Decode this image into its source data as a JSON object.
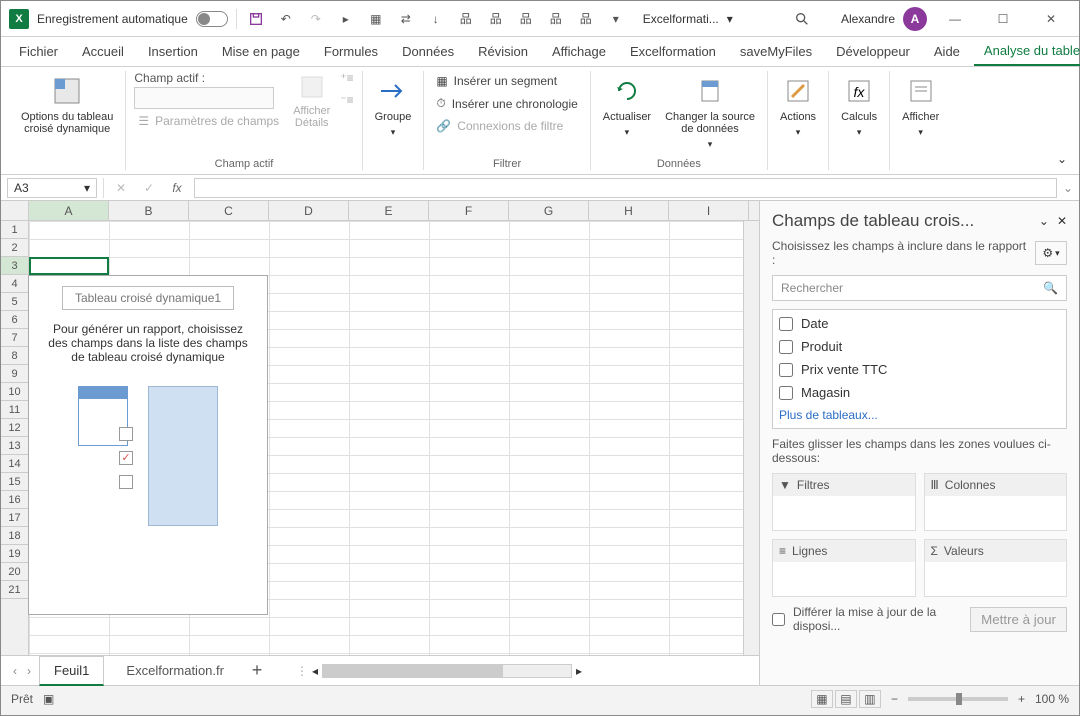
{
  "titlebar": {
    "autosave": "Enregistrement automatique",
    "filename": "Excelformati...",
    "user": "Alexandre",
    "user_initial": "A"
  },
  "tabs": [
    "Fichier",
    "Accueil",
    "Insertion",
    "Mise en page",
    "Formules",
    "Données",
    "Révision",
    "Affichage",
    "Excelformation",
    "saveMyFiles",
    "Développeur",
    "Aide",
    "Analyse du tableau croisé dynamiq"
  ],
  "active_tab_index": 12,
  "ribbon": {
    "options": "Options du tableau\ncroisé dynamique",
    "champ_actif_label": "Champ actif :",
    "champ_params": "Paramètres de champs",
    "afficher_details": "Afficher\nDétails",
    "group_champactif": "Champ actif",
    "groupe": "Groupe",
    "insert_segment": "Insérer un segment",
    "insert_chrono": "Insérer une chronologie",
    "filter_conn": "Connexions de filtre",
    "group_filtrer": "Filtrer",
    "actualiser": "Actualiser",
    "changer_source": "Changer la source\nde données",
    "group_donnees": "Données",
    "actions": "Actions",
    "calculs": "Calculs",
    "afficher": "Afficher"
  },
  "namebox": "A3",
  "columns": [
    "A",
    "B",
    "C",
    "D",
    "E",
    "F",
    "G",
    "H",
    "I"
  ],
  "rows": [
    "1",
    "2",
    "3",
    "4",
    "5",
    "6",
    "7",
    "8",
    "9",
    "10",
    "11",
    "12",
    "13",
    "14",
    "15",
    "16",
    "17",
    "18",
    "19",
    "20",
    "21"
  ],
  "pivot": {
    "name": "Tableau croisé dynamique1",
    "hint": "Pour générer un rapport, choisissez des champs dans la liste des champs de tableau croisé dynamique"
  },
  "pane": {
    "title": "Champs de tableau crois...",
    "subtitle": "Choisissez les champs à inclure dans le rapport :",
    "search_placeholder": "Rechercher",
    "fields": [
      "Date",
      "Produit",
      "Prix vente TTC",
      "Magasin"
    ],
    "more_tables": "Plus de tableaux...",
    "drag_hint": "Faites glisser les champs dans les zones voulues ci-dessous:",
    "zone_filters": "Filtres",
    "zone_columns": "Colonnes",
    "zone_rows": "Lignes",
    "zone_values": "Valeurs",
    "defer": "Différer la mise à jour de la disposi...",
    "update": "Mettre à jour"
  },
  "sheets": {
    "tab1": "Feuil1",
    "tab2": "Excelformation.fr"
  },
  "status": {
    "ready": "Prêt",
    "zoom": "100 %"
  }
}
